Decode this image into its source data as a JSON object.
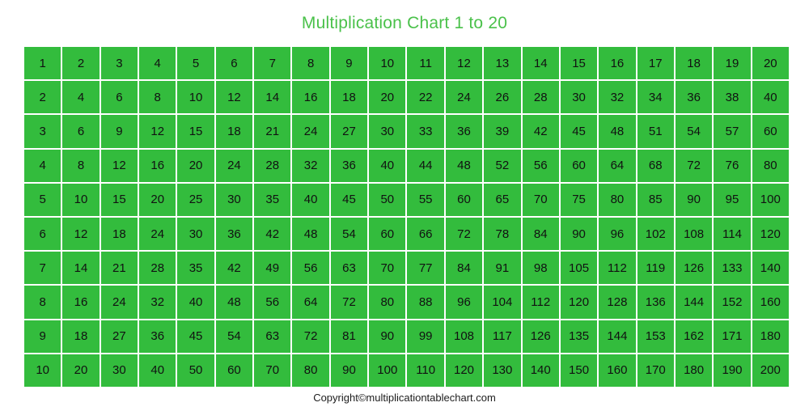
{
  "header": {
    "title": "Multiplication Chart 1 to 20"
  },
  "footer": {
    "copyright": "Copyright©multiplicationtablechart.com"
  },
  "colors": {
    "title_green": "#4ac14a",
    "cell_green": "#33bc3d",
    "cell_text": "#111111",
    "grid_line": "#ffffff",
    "page_background": "#ffffff",
    "footer_text": "#1c1c1c"
  },
  "chart_data": {
    "type": "table",
    "title": "Multiplication Chart 1 to 20",
    "xlabel": "",
    "ylabel": "",
    "rows": 10,
    "columns": 20,
    "row_factors": [
      1,
      2,
      3,
      4,
      5,
      6,
      7,
      8,
      9,
      10
    ],
    "column_factors": [
      1,
      2,
      3,
      4,
      5,
      6,
      7,
      8,
      9,
      10,
      11,
      12,
      13,
      14,
      15,
      16,
      17,
      18,
      19,
      20
    ],
    "grid": true,
    "legend": "none",
    "values": [
      [
        1,
        2,
        3,
        4,
        5,
        6,
        7,
        8,
        9,
        10,
        11,
        12,
        13,
        14,
        15,
        16,
        17,
        18,
        19,
        20
      ],
      [
        2,
        4,
        6,
        8,
        10,
        12,
        14,
        16,
        18,
        20,
        22,
        24,
        26,
        28,
        30,
        32,
        34,
        36,
        38,
        40
      ],
      [
        3,
        6,
        9,
        12,
        15,
        18,
        21,
        24,
        27,
        30,
        33,
        36,
        39,
        42,
        45,
        48,
        51,
        54,
        57,
        60
      ],
      [
        4,
        8,
        12,
        16,
        20,
        24,
        28,
        32,
        36,
        40,
        44,
        48,
        52,
        56,
        60,
        64,
        68,
        72,
        76,
        80
      ],
      [
        5,
        10,
        15,
        20,
        25,
        30,
        35,
        40,
        45,
        50,
        55,
        60,
        65,
        70,
        75,
        80,
        85,
        90,
        95,
        100
      ],
      [
        6,
        12,
        18,
        24,
        30,
        36,
        42,
        48,
        54,
        60,
        66,
        72,
        78,
        84,
        90,
        96,
        102,
        108,
        114,
        120
      ],
      [
        7,
        14,
        21,
        28,
        35,
        42,
        49,
        56,
        63,
        70,
        77,
        84,
        91,
        98,
        105,
        112,
        119,
        126,
        133,
        140
      ],
      [
        8,
        16,
        24,
        32,
        40,
        48,
        56,
        64,
        72,
        80,
        88,
        96,
        104,
        112,
        120,
        128,
        136,
        144,
        152,
        160
      ],
      [
        9,
        18,
        27,
        36,
        45,
        54,
        63,
        72,
        81,
        90,
        99,
        108,
        117,
        126,
        135,
        144,
        153,
        162,
        171,
        180
      ],
      [
        10,
        20,
        30,
        40,
        50,
        60,
        70,
        80,
        90,
        100,
        110,
        120,
        130,
        140,
        150,
        160,
        170,
        180,
        190,
        200
      ]
    ]
  }
}
